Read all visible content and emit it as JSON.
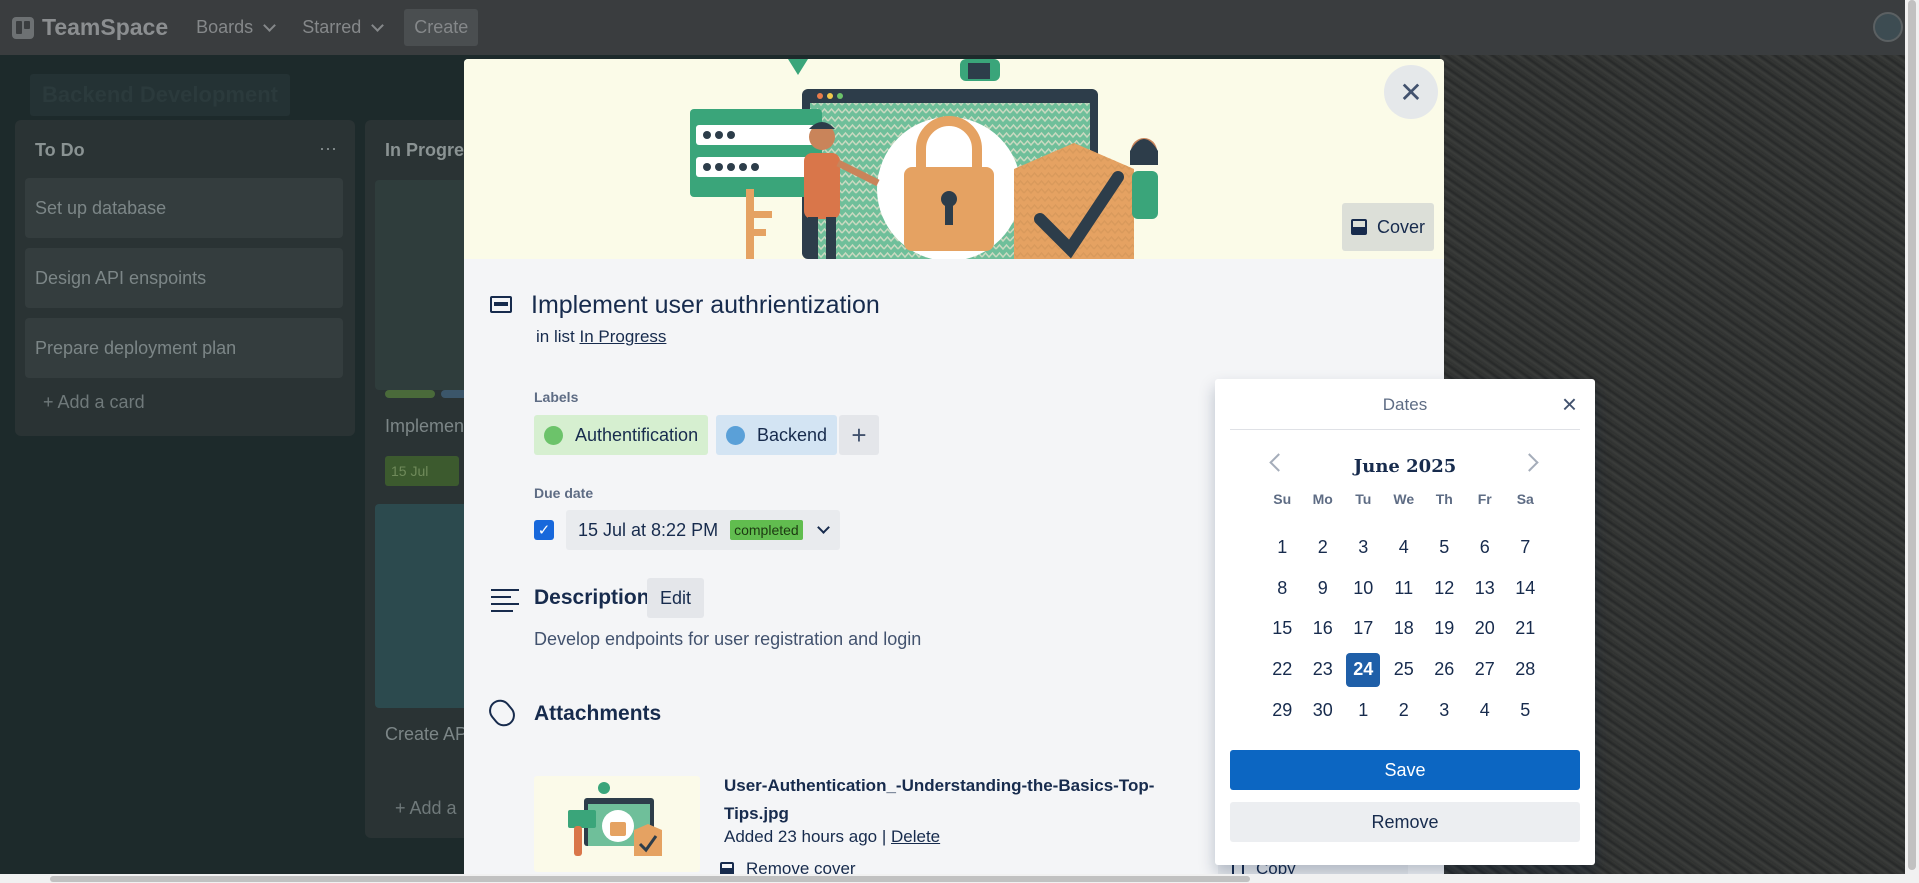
{
  "topbar": {
    "brand": "TeamSpace",
    "nav": [
      "Boards",
      "Starred"
    ],
    "create_label": "Create"
  },
  "board": {
    "title": "Backend Development",
    "lists": [
      {
        "title": "To Do",
        "cards": [
          "Set up database",
          "Design API enspoints",
          "Prepare deployment plan"
        ],
        "add_card": "+ Add a card"
      },
      {
        "title": "In Progress",
        "card1_text": "Implemen",
        "card1_badge": "15 Jul",
        "card2_text": "Create API",
        "add_card": "+ Add a"
      }
    ]
  },
  "modal": {
    "cover_button": "Cover",
    "title": "Implement user authrientization",
    "in_list_prefix": "in list",
    "in_list_name": "In Progress",
    "labels_heading": "Labels",
    "labels": [
      {
        "text": "Authentification",
        "bg": "#d6efd0",
        "dot": "#6cc36a"
      },
      {
        "text": "Backend",
        "bg": "#d3e4f3",
        "dot": "#5aa0d8"
      }
    ],
    "add_label": "+",
    "due_heading": "Due date",
    "due_text": "15 Jul at 8:22 PM",
    "due_badge": "completed",
    "description_heading": "Description",
    "edit_label": "Edit",
    "description": "Develop endpoints for user registration and login",
    "attachments_heading": "Attachments",
    "attachment": {
      "name": "User-Authentication_-Understanding-the-Basics-Top-Tips.jpg",
      "added": "Added 23 hours ago |",
      "delete": "Delete",
      "remove_cover": "Remove cover"
    },
    "copy_label": "Copy"
  },
  "dates": {
    "title": "Dates",
    "month": "June 2025",
    "dow": [
      "Su",
      "Mo",
      "Tu",
      "We",
      "Th",
      "Fr",
      "Sa"
    ],
    "weeks": [
      [
        "1",
        "2",
        "3",
        "4",
        "5",
        "6",
        "7"
      ],
      [
        "8",
        "9",
        "10",
        "11",
        "12",
        "13",
        "14"
      ],
      [
        "15",
        "16",
        "17",
        "18",
        "19",
        "20",
        "21"
      ],
      [
        "22",
        "23",
        "24",
        "25",
        "26",
        "27",
        "28"
      ],
      [
        "29",
        "30",
        "1",
        "2",
        "3",
        "4",
        "5"
      ]
    ],
    "selected": "24",
    "save": "Save",
    "remove": "Remove"
  }
}
